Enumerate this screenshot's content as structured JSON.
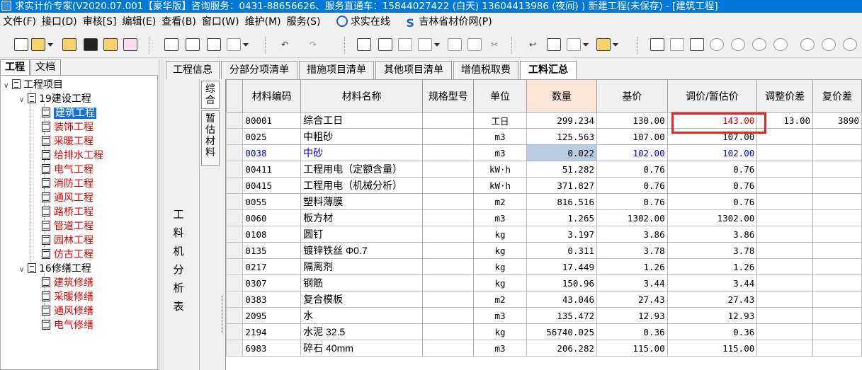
{
  "title": "求实计价专家(V2020.07.001【豪华版】咨询服务：0431-88656626、服务直通车：15844027422 (白天) 13604413986 (夜间) ) 新建工程(未保存) - [建筑工程]",
  "menu": [
    "文件(F)",
    "接口(D)",
    "审核[S]",
    "编辑(E)",
    "查看(B)",
    "窗口(W)",
    "维护(M)",
    "服务(S)"
  ],
  "links": [
    "求实在线",
    "吉林省材价网(P)"
  ],
  "left_tabs": [
    "工程",
    "文档"
  ],
  "tree": {
    "root": "工程项目",
    "groups": [
      {
        "label": "19建设工程",
        "items": [
          "建筑工程",
          "装饰工程",
          "采暖工程",
          "给排水工程",
          "电气工程",
          "消防工程",
          "通风工程",
          "路桥工程",
          "管道工程",
          "园林工程",
          "仿古工程"
        ]
      },
      {
        "label": "16修缮工程",
        "items": [
          "建筑修缮",
          "采暖修缮",
          "通风修缮",
          "电气修缮"
        ]
      }
    ],
    "selected": "建筑工程"
  },
  "tabs": [
    "工程信息",
    "分部分项清单",
    "措施项目清单",
    "其他项目清单",
    "增值税取费",
    "工料汇总"
  ],
  "active_tab": "工料汇总",
  "side_label": "工料机分析表",
  "vtabs": [
    "综合",
    "暂估材料"
  ],
  "table": {
    "headers": [
      "材料编码",
      "材料名称",
      "规格型号",
      "单位",
      "数量",
      "基价",
      "调价/暂估价",
      "调整价差",
      "复价差"
    ],
    "rows": [
      [
        "00001",
        "综合工日",
        "",
        "工日",
        "299.234",
        "130.00",
        "143.00",
        "13.00",
        "3890"
      ],
      [
        "0025",
        "中粗砂",
        "",
        "m3",
        "125.563",
        "107.00",
        "107.00",
        "",
        ""
      ],
      [
        "0038",
        "中砂",
        "",
        "m3",
        "0.022",
        "102.00",
        "102.00",
        "",
        ""
      ],
      [
        "00411",
        "工程用电（定额含量）",
        "",
        "kW·h",
        "51.282",
        "0.76",
        "0.76",
        "",
        ""
      ],
      [
        "00415",
        "工程用电（机械分析）",
        "",
        "kW·h",
        "371.827",
        "0.76",
        "0.76",
        "",
        ""
      ],
      [
        "0055",
        "塑料薄膜",
        "",
        "m2",
        "816.516",
        "0.76",
        "0.76",
        "",
        ""
      ],
      [
        "0060",
        "板方材",
        "",
        "m3",
        "1.265",
        "1302.00",
        "1302.00",
        "",
        ""
      ],
      [
        "0108",
        "圆钉",
        "",
        "kg",
        "3.197",
        "3.86",
        "3.86",
        "",
        ""
      ],
      [
        "0135",
        "镀锌铁丝 Φ0.7",
        "",
        "kg",
        "0.311",
        "3.78",
        "3.78",
        "",
        ""
      ],
      [
        "0217",
        "隔离剂",
        "",
        "kg",
        "17.449",
        "1.26",
        "1.26",
        "",
        ""
      ],
      [
        "0307",
        "钢筋",
        "",
        "kg",
        "150.96",
        "3.44",
        "3.44",
        "",
        ""
      ],
      [
        "0383",
        "复合模板",
        "",
        "m2",
        "43.046",
        "27.43",
        "27.43",
        "",
        ""
      ],
      [
        "2095",
        "水",
        "",
        "m3",
        "135.472",
        "12.93",
        "12.93",
        "",
        ""
      ],
      [
        "2194",
        "水泥 32.5",
        "",
        "kg",
        "56740.025",
        "0.36",
        "0.36",
        "",
        ""
      ],
      [
        "6983",
        "碎石 40mm",
        "",
        "m3",
        "206.282",
        "115.00",
        "115.00",
        "",
        ""
      ]
    ]
  },
  "colors": {
    "title_bg": "#0078d7",
    "tree_red": "#e00000",
    "highlight": "#e02020",
    "selected_blue": "#0000dd",
    "qty_header": "#fbe5d6"
  }
}
